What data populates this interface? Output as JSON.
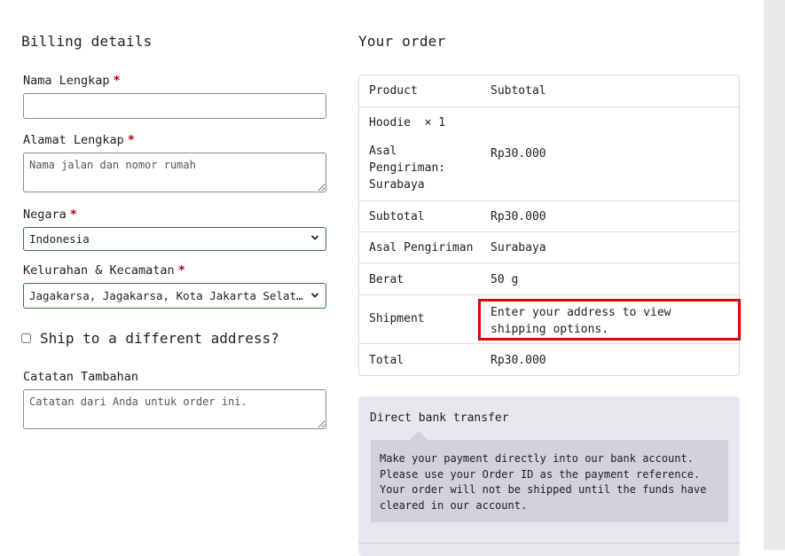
{
  "billing": {
    "title": "Billing details",
    "nama_label": "Nama Lengkap",
    "nama_value": "",
    "alamat_label": "Alamat Lengkap",
    "alamat_placeholder": "Nama jalan dan nomor rumah",
    "negara_label": "Negara",
    "negara_value": "Indonesia",
    "kelurahan_label": "Kelurahan & Kecamatan",
    "kelurahan_value": "Jagakarsa, Jagakarsa, Kota Jakarta Selatan, DKI Jakarta",
    "required_mark": "*",
    "ship_different_label": "Ship to a different address?",
    "ship_different_checked": false,
    "catatan_label": "Catatan Tambahan",
    "catatan_placeholder": "Catatan dari Anda untuk order ini."
  },
  "order": {
    "title": "Your order",
    "header": {
      "product": "Product",
      "subtotal": "Subtotal"
    },
    "item": {
      "name": "Hoodie",
      "qty": "× 1",
      "origin_label_1": "Asal",
      "origin_label_2": "Pengiriman:",
      "origin_value": "Surabaya",
      "price": "Rp30.000"
    },
    "subtotal": {
      "label": "Subtotal",
      "value": "Rp30.000"
    },
    "asal": {
      "label": "Asal Pengiriman",
      "value": "Surabaya"
    },
    "berat": {
      "label": "Berat",
      "value": "50 g"
    },
    "shipment": {
      "label": "Shipment",
      "value": "Enter your address to view shipping options."
    },
    "total": {
      "label": "Total",
      "value": "Rp30.000"
    }
  },
  "payment": {
    "method_title": "Direct bank transfer",
    "description": "Make your payment directly into our bank account. Please use your Order ID as the payment reference. Your order will not be shipped until the funds have cleared in our account."
  },
  "colors": {
    "required": "#b00000",
    "highlight": "#e00000",
    "payment_bg": "#e9e6ed",
    "payment_box": "#d4d0dd",
    "select_border": "#2f7a2f"
  }
}
